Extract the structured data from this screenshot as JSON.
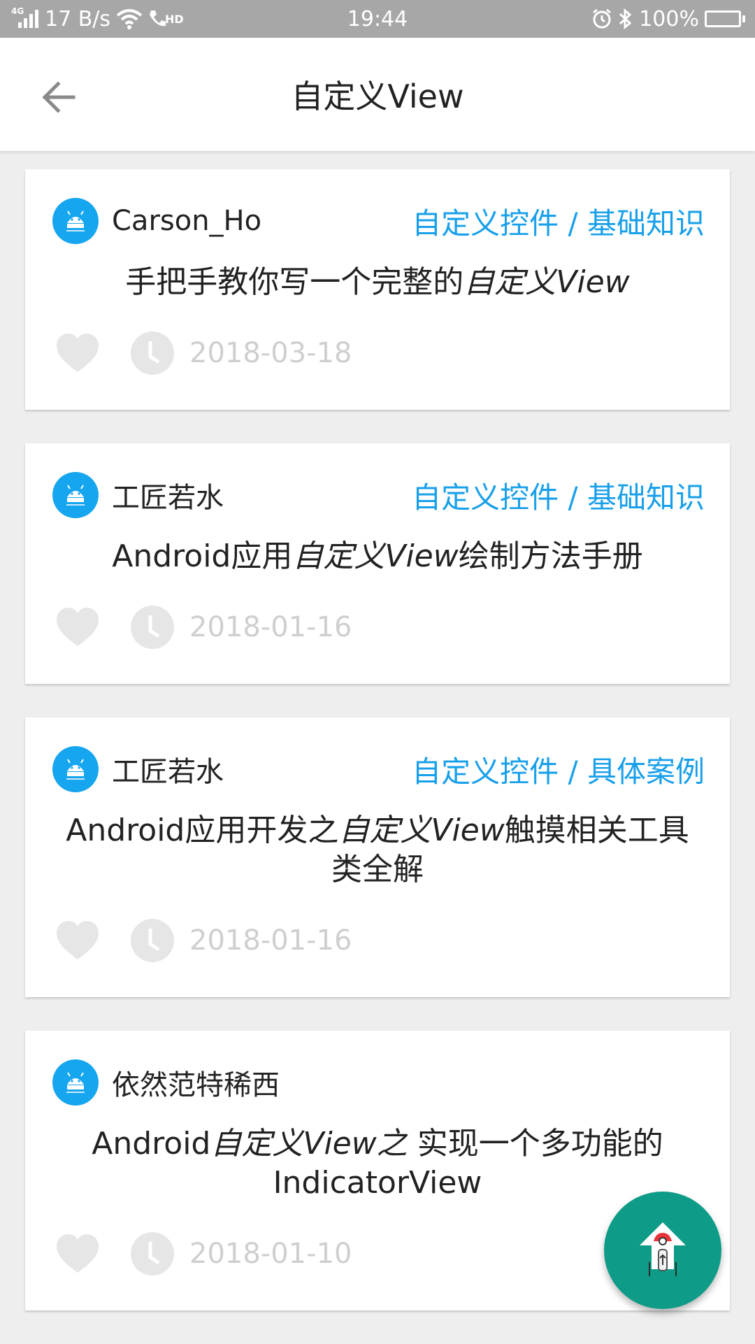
{
  "status_bar": {
    "network": "4G",
    "speed": "17 B/s",
    "hd": "HD",
    "time": "19:44",
    "battery": "100%"
  },
  "toolbar": {
    "title": "自定义View"
  },
  "articles": [
    {
      "author": "Carson_Ho",
      "chapter": "自定义控件 / 基础知识",
      "title_before": "手把手教你写一个完整的",
      "title_em": "自定义View",
      "title_after": "",
      "date": "2018-03-18"
    },
    {
      "author": "工匠若水",
      "chapter": "自定义控件 / 基础知识",
      "title_before": "Android应用",
      "title_em": "自定义View",
      "title_after": "绘制方法手册",
      "date": "2018-01-16"
    },
    {
      "author": "工匠若水",
      "chapter": "自定义控件 / 具体案例",
      "title_before": "Android应用开发之",
      "title_em": "自定义View",
      "title_after": "触摸相关工具类全解",
      "date": "2018-01-16"
    },
    {
      "author": "依然范特稀西",
      "chapter": "",
      "title_before": "Android",
      "title_em": "自定义View之",
      "title_after": " 实现一个多功能的IndicatorView",
      "date": "2018-01-10"
    }
  ],
  "colors": {
    "accent": "#19a0ea",
    "avatar": "#16a5ef",
    "fab": "#0e9b87",
    "muted": "#cfcfcf"
  },
  "icons": {
    "back": "arrow-left-icon",
    "avatar": "android-robot-icon",
    "like": "heart-icon",
    "time": "clock-icon",
    "fab": "rocket-up-icon"
  }
}
